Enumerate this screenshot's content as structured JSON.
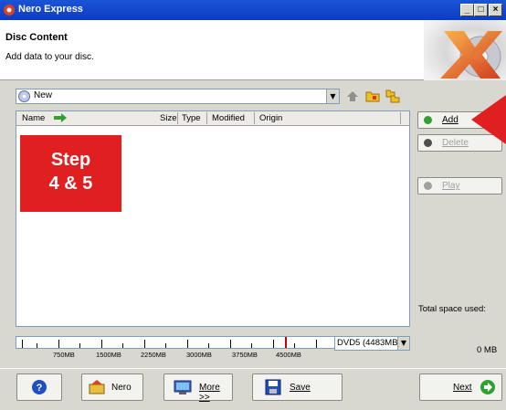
{
  "window": {
    "title": "Nero Express"
  },
  "header": {
    "title": "Disc Content",
    "subtitle": "Add data to your disc."
  },
  "compilation": {
    "name": "New"
  },
  "file_list": {
    "columns": [
      "Name",
      "Size",
      "Type",
      "Modified",
      "Origin"
    ]
  },
  "overlay": {
    "line1": "Step",
    "line2": "4 & 5"
  },
  "side_buttons": {
    "add": "Add",
    "delete": "Delete",
    "play": "Play"
  },
  "capacity": {
    "ticks": [
      "750MB",
      "1500MB",
      "2250MB",
      "3000MB",
      "3750MB",
      "4500MB"
    ],
    "disc_type": "DVD5 (4483MB",
    "total_label": "Total space used:",
    "total_value": "0 MB"
  },
  "bottom": {
    "nero": "Nero",
    "more": "More >>",
    "save": "Save",
    "next": "Next"
  },
  "colors": {
    "titlebar": "#0b3cc4",
    "step_overlay": "#e02020",
    "capacity_marker": "#cc0000"
  }
}
